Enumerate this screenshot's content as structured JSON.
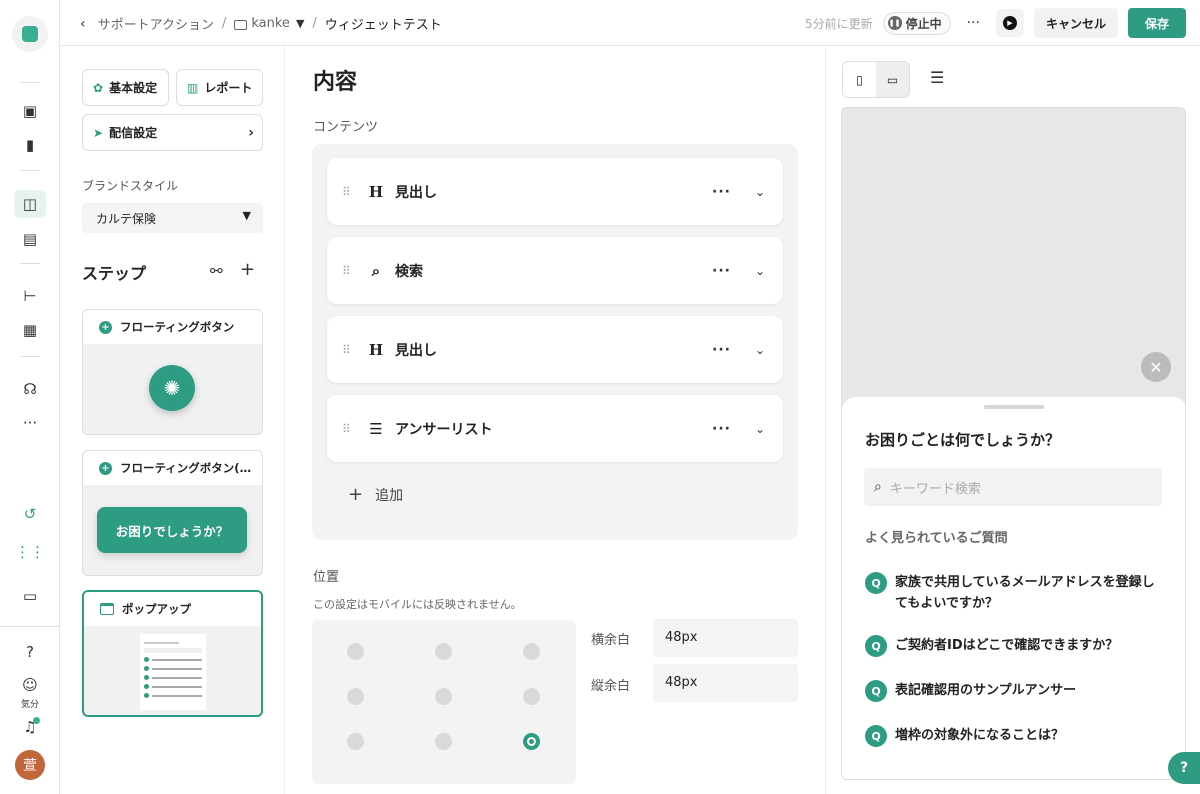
{
  "header": {
    "breadcrumb_root": "サポートアクション",
    "folder": "kanke",
    "current": "ウィジェットテスト",
    "updated": "5分前に更新",
    "status": "停止中",
    "more": "···",
    "cancel": "キャンセル",
    "save": "保存"
  },
  "rail": {
    "kibun": "気分",
    "avatar": "萱"
  },
  "left": {
    "basic": "基本設定",
    "report": "レポート",
    "delivery": "配信設定",
    "brand_label": "ブランドスタイル",
    "brand_value": "カルテ保険",
    "steps_title": "ステップ",
    "cards": [
      {
        "title": "フローティングボタン"
      },
      {
        "title": "フローティングボタン(…",
        "button": "お困りでしょうか？"
      },
      {
        "title": "ポップアップ"
      }
    ]
  },
  "middle": {
    "title": "内容",
    "contents_label": "コンテンツ",
    "blocks": [
      {
        "icon": "H",
        "label": "見出し"
      },
      {
        "icon": "⌕",
        "label": "検索"
      },
      {
        "icon": "H",
        "label": "見出し"
      },
      {
        "icon": "☰",
        "label": "アンサーリスト"
      }
    ],
    "add": "追加",
    "position_label": "位置",
    "position_note": "この設定はモバイルには反映されません。",
    "h_margin_label": "横余白",
    "h_margin_value": "48px",
    "v_margin_label": "縦余白",
    "v_margin_value": "48px"
  },
  "preview": {
    "question": "お困りごとは何でしょうか？",
    "search_placeholder": "キーワード検索",
    "popular_label": "よく見られているご質問",
    "faqs": [
      "家族で共用しているメールアドレスを登録してもよいですか？",
      "ご契約者IDはどこで確認できますか？",
      "表記確認用のサンプルアンサー",
      "増枠の対象外になることは？"
    ],
    "faq_badge": "Q",
    "help": "?"
  },
  "colors": {
    "accent": "#2e9c82"
  }
}
